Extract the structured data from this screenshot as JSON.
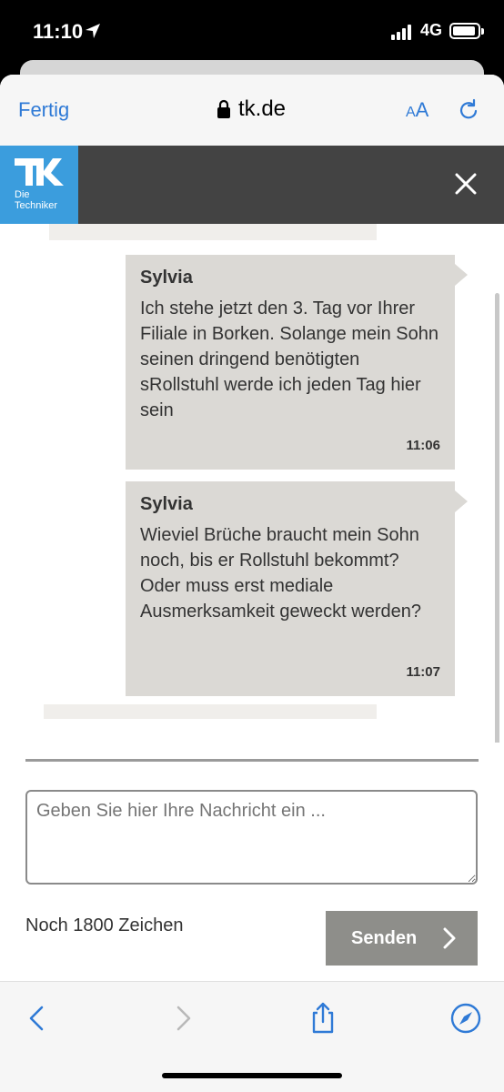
{
  "status_bar": {
    "time": "11:10",
    "network": "4G",
    "icons": [
      "location-arrow-icon",
      "signal-icon",
      "battery-icon"
    ]
  },
  "browser": {
    "done_label": "Fertig",
    "url": "tk.de",
    "text_size_label_small": "A",
    "text_size_label_large": "A"
  },
  "header": {
    "logo_text_line1": "Die",
    "logo_text_line2": "Techniker",
    "brand_color": "#3b9ddd"
  },
  "messages": [
    {
      "sender": "Sylvia",
      "text": "Ich stehe jetzt den 3. Tag vor Ihrer Filiale in Borken. Solange mein Sohn seinen dringend benötigten sRollstuhl werde ich jeden Tag hier sein",
      "time": "11:06"
    },
    {
      "sender": "Sylvia",
      "text": "Wieviel Brüche braucht mein Sohn noch, bis er Rollstuhl bekommt? Oder muss erst mediale Ausmerksamkeit geweckt werden?",
      "time": "11:07"
    }
  ],
  "composer": {
    "placeholder": "Geben Sie hier Ihre Nachricht ein ...",
    "counter": "Noch 1800 Zeichen",
    "send_label": "Senden"
  }
}
